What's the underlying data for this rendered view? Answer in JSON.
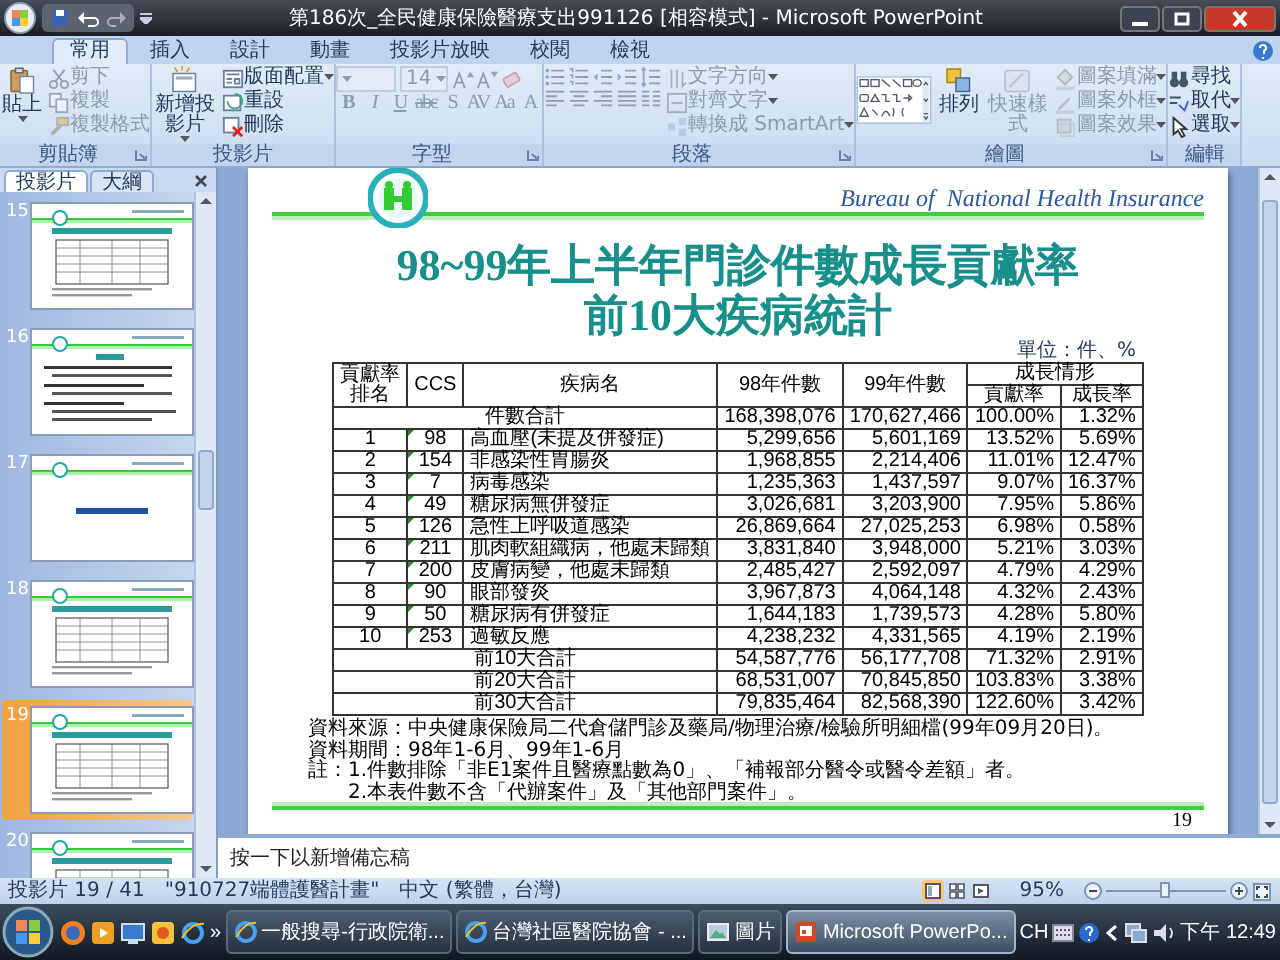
{
  "window": {
    "title": "第186次_全民健康保險醫療支出991126 [相容模式] - Microsoft PowerPoint"
  },
  "ribbon": {
    "tabs": [
      {
        "label": "常用",
        "selected": true
      },
      {
        "label": "插入",
        "selected": false
      },
      {
        "label": "設計",
        "selected": false
      },
      {
        "label": "動畫",
        "selected": false
      },
      {
        "label": "投影片放映",
        "selected": false
      },
      {
        "label": "校閱",
        "selected": false
      },
      {
        "label": "檢視",
        "selected": false
      }
    ],
    "groups": [
      {
        "label": "剪貼簿",
        "launcher": true,
        "sections": [
          [
            [
              {
                "kind": "large",
                "label": "貼上",
                "disabled": false,
                "menu": true
              }
            ]
          ],
          [
            [
              {
                "kind": "small",
                "label": "剪下",
                "disabled": true
              }
            ],
            [
              {
                "kind": "small",
                "label": "複製",
                "disabled": true
              }
            ],
            [
              {
                "kind": "small",
                "label": "複製格式",
                "disabled": true
              }
            ]
          ]
        ]
      },
      {
        "label": "投影片",
        "launcher": false,
        "sections": [
          [
            [
              {
                "kind": "large",
                "label": "新增投影片",
                "disabled": false,
                "menu": true
              }
            ]
          ],
          [
            [
              {
                "kind": "small",
                "label": "版面配置",
                "disabled": false,
                "menu": true
              }
            ],
            [
              {
                "kind": "small",
                "label": "重設",
                "disabled": false
              }
            ],
            [
              {
                "kind": "small",
                "label": "刪除",
                "disabled": false
              }
            ]
          ]
        ]
      },
      {
        "label": "字型",
        "launcher": true,
        "sections": [
          [
            [
              {
                "kind": "field",
                "disabled": true
              },
              {
                "kind": "field",
                "value": "14",
                "disabled": true
              },
              {
                "kind": "icon",
                "disabled": true
              },
              {
                "kind": "icon",
                "disabled": true
              },
              {
                "kind": "icon",
                "disabled": true
              }
            ],
            [
              {
                "kind": "glyph",
                "label": "B",
                "disabled": true
              },
              {
                "kind": "glyph",
                "label": "I",
                "disabled": true
              },
              {
                "kind": "glyph",
                "label": "U",
                "disabled": true
              },
              {
                "kind": "glyph",
                "label": "abc",
                "disabled": true
              },
              {
                "kind": "glyph",
                "label": "S",
                "disabled": true
              },
              {
                "kind": "glyph",
                "label": "AV",
                "disabled": true
              },
              {
                "kind": "glyph",
                "label": "Aa",
                "disabled": true
              },
              {
                "kind": "glyph",
                "label": "A",
                "disabled": true
              }
            ]
          ]
        ]
      },
      {
        "label": "段落",
        "launcher": true,
        "sections": [
          [
            [
              {
                "kind": "icon",
                "disabled": true
              },
              {
                "kind": "icon",
                "disabled": true
              },
              {
                "kind": "icon",
                "disabled": true
              },
              {
                "kind": "icon",
                "disabled": true
              },
              {
                "kind": "icon",
                "disabled": true
              }
            ],
            [
              {
                "kind": "icon",
                "disabled": true
              },
              {
                "kind": "icon",
                "disabled": true
              },
              {
                "kind": "icon",
                "disabled": true
              },
              {
                "kind": "icon",
                "disabled": true
              },
              {
                "kind": "icon",
                "disabled": true
              }
            ]
          ],
          [
            [
              {
                "kind": "small",
                "label": "文字方向",
                "disabled": true,
                "menu": true
              }
            ],
            [
              {
                "kind": "small",
                "label": "對齊文字",
                "disabled": true,
                "menu": true
              }
            ],
            [
              {
                "kind": "small",
                "label": "轉換成 SmartArt",
                "disabled": true,
                "menu": true
              }
            ]
          ]
        ]
      },
      {
        "label": "繪圖",
        "launcher": true,
        "sections": [
          [
            [
              {
                "kind": "gallery"
              }
            ]
          ],
          [
            [
              {
                "kind": "large",
                "label": "排列",
                "disabled": false
              }
            ]
          ],
          [
            [
              {
                "kind": "large",
                "label": "快速樣式",
                "disabled": true
              }
            ]
          ],
          [
            [
              {
                "kind": "small",
                "label": "圖案填滿",
                "disabled": true,
                "menu": true
              }
            ],
            [
              {
                "kind": "small",
                "label": "圖案外框",
                "disabled": true,
                "menu": true
              }
            ],
            [
              {
                "kind": "small",
                "label": "圖案效果",
                "disabled": true,
                "menu": true
              }
            ]
          ]
        ]
      },
      {
        "label": "編輯",
        "launcher": false,
        "sections": [
          [
            [
              {
                "kind": "small",
                "label": "尋找",
                "disabled": false
              }
            ],
            [
              {
                "kind": "small",
                "label": "取代",
                "disabled": false,
                "menu": true
              }
            ],
            [
              {
                "kind": "small",
                "label": "選取",
                "disabled": false,
                "menu": true
              }
            ]
          ]
        ]
      }
    ]
  },
  "slides_panel": {
    "tabs": [
      {
        "label": "投影片",
        "selected": true
      },
      {
        "label": "大綱",
        "selected": false
      }
    ],
    "slides": [
      {
        "number": "15",
        "kind": "table",
        "selected": false
      },
      {
        "number": "16",
        "kind": "text",
        "selected": false
      },
      {
        "number": "17",
        "kind": "section",
        "selected": false
      },
      {
        "number": "18",
        "kind": "table",
        "selected": false
      },
      {
        "number": "19",
        "kind": "table",
        "selected": true
      },
      {
        "number": "20",
        "kind": "table",
        "selected": false
      }
    ]
  },
  "slide": {
    "header": "Bureau of  National Health Insurance",
    "title_lines": [
      "98~99年上半年門診件數成長貢獻率",
      "前10大疾病統計"
    ],
    "unit": "單位：件、%",
    "table": {
      "header": {
        "rank": "貢獻率排名",
        "ccs": "CCS",
        "name": "疾病名",
        "y98": "98年件數",
        "y99": "99年件數",
        "growth": "成長情形",
        "share": "貢獻率",
        "rate": "成長率"
      },
      "rows": [
        {
          "kind": "total",
          "label": "件數合計",
          "y98": "168,398,076",
          "y99": "170,627,466",
          "share": "100.00%",
          "rate": "1.32%"
        },
        {
          "kind": "item",
          "rank": "1",
          "ccs": "98",
          "name": "高血壓(未提及併發症)",
          "y98": "5,299,656",
          "y99": "5,601,169",
          "share": "13.52%",
          "rate": "5.69%"
        },
        {
          "kind": "item",
          "rank": "2",
          "ccs": "154",
          "name": "非感染性胃腸炎",
          "y98": "1,968,855",
          "y99": "2,214,406",
          "share": "11.01%",
          "rate": "12.47%"
        },
        {
          "kind": "item",
          "rank": "3",
          "ccs": "7",
          "name": "病毒感染",
          "y98": "1,235,363",
          "y99": "1,437,597",
          "share": "9.07%",
          "rate": "16.37%"
        },
        {
          "kind": "item",
          "rank": "4",
          "ccs": "49",
          "name": "糖尿病無併發症",
          "y98": "3,026,681",
          "y99": "3,203,900",
          "share": "7.95%",
          "rate": "5.86%"
        },
        {
          "kind": "item",
          "rank": "5",
          "ccs": "126",
          "name": "急性上呼吸道感染",
          "y98": "26,869,664",
          "y99": "27,025,253",
          "share": "6.98%",
          "rate": "0.58%"
        },
        {
          "kind": "item",
          "rank": "6",
          "ccs": "211",
          "name": "肌肉軟組織病，他處未歸類",
          "y98": "3,831,840",
          "y99": "3,948,000",
          "share": "5.21%",
          "rate": "3.03%"
        },
        {
          "kind": "item",
          "rank": "7",
          "ccs": "200",
          "name": "皮膚病變，他處未歸類",
          "y98": "2,485,427",
          "y99": "2,592,097",
          "share": "4.79%",
          "rate": "4.29%"
        },
        {
          "kind": "item",
          "rank": "8",
          "ccs": "90",
          "name": "眼部發炎",
          "y98": "3,967,873",
          "y99": "4,064,148",
          "share": "4.32%",
          "rate": "2.43%"
        },
        {
          "kind": "item",
          "rank": "9",
          "ccs": "50",
          "name": "糖尿病有併發症",
          "y98": "1,644,183",
          "y99": "1,739,573",
          "share": "4.28%",
          "rate": "5.80%"
        },
        {
          "kind": "item",
          "rank": "10",
          "ccs": "253",
          "name": "過敏反應",
          "y98": "4,238,232",
          "y99": "4,331,565",
          "share": "4.19%",
          "rate": "2.19%"
        },
        {
          "kind": "total",
          "label": "前10大合計",
          "y98": "54,587,776",
          "y99": "56,177,708",
          "share": "71.32%",
          "rate": "2.91%"
        },
        {
          "kind": "total",
          "label": "前20大合計",
          "y98": "68,531,007",
          "y99": "70,845,850",
          "share": "103.83%",
          "rate": "3.38%"
        },
        {
          "kind": "total",
          "label": "前30大合計",
          "y98": "79,835,464",
          "y99": "82,568,390",
          "share": "122.60%",
          "rate": "3.42%"
        }
      ]
    },
    "notes": [
      {
        "text": "資料來源：中央健康保險局二代倉儲門診及藥局/物理治療/檢驗所明細檔(99年09月20日)。",
        "indent": false
      },
      {
        "text": "資料期間：98年1-6月、99年1-6月",
        "indent": false
      },
      {
        "text": "註：1.件數排除「非E1案件且醫療點數為0」、「補報部分醫令或醫令差額」者。",
        "indent": false
      },
      {
        "text": "2.本表件數不含「代辦案件」及「其他部門案件」。",
        "indent": true
      }
    ],
    "page": "19"
  },
  "notes_pane": {
    "placeholder": "按一下以新增備忘稿"
  },
  "status_bar": {
    "slide": "投影片 19 / 41",
    "theme": "\"910727端體護醫計畫\"",
    "language": "中文 (繁體，台灣)",
    "views": [
      {
        "selected": true
      },
      {
        "selected": false
      },
      {
        "selected": false
      }
    ],
    "zoom": "95%",
    "zoom_slider": {
      "level": 0.48
    }
  },
  "taskbar": {
    "overflow": "»",
    "tasks": [
      {
        "label": "一般搜尋-行政院衛...",
        "selected": false
      },
      {
        "label": "台灣社區醫院協會 - ...",
        "selected": false
      },
      {
        "label": "圖片",
        "selected": false
      },
      {
        "label": "Microsoft PowerPo...",
        "selected": true
      }
    ],
    "input_language": "CH",
    "clock": "下午 12:49"
  }
}
